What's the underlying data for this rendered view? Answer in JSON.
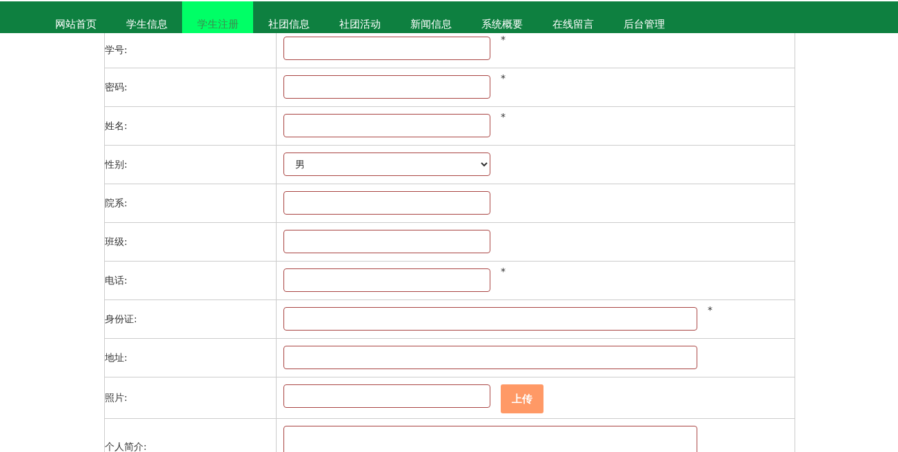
{
  "nav": [
    {
      "label": "网站首页",
      "selected": false
    },
    {
      "label": "学生信息",
      "selected": false
    },
    {
      "label": "学生注册",
      "selected": true
    },
    {
      "label": "社团信息",
      "selected": false
    },
    {
      "label": "社团活动",
      "selected": false
    },
    {
      "label": "新闻信息",
      "selected": false
    },
    {
      "label": "系统概要",
      "selected": false
    },
    {
      "label": "在线留言",
      "selected": false
    },
    {
      "label": "后台管理",
      "selected": false
    }
  ],
  "form": [
    {
      "label": "学号:",
      "kind": "text",
      "note": "*"
    },
    {
      "label": "密码:",
      "kind": "text",
      "note": "*"
    },
    {
      "label": "姓名:",
      "kind": "text",
      "note": "*"
    },
    {
      "label": "性别:",
      "kind": "select",
      "value": "男"
    },
    {
      "label": "院系:",
      "kind": "text"
    },
    {
      "label": "班级:",
      "kind": "text"
    },
    {
      "label": "电话:",
      "kind": "text",
      "note": "*"
    },
    {
      "label": "身份证:",
      "kind": "wide",
      "note": "*"
    },
    {
      "label": "地址:",
      "kind": "wide"
    },
    {
      "label": "照片:",
      "kind": "upload",
      "button": "上传"
    },
    {
      "label": "个人简介:",
      "kind": "textarea"
    }
  ]
}
